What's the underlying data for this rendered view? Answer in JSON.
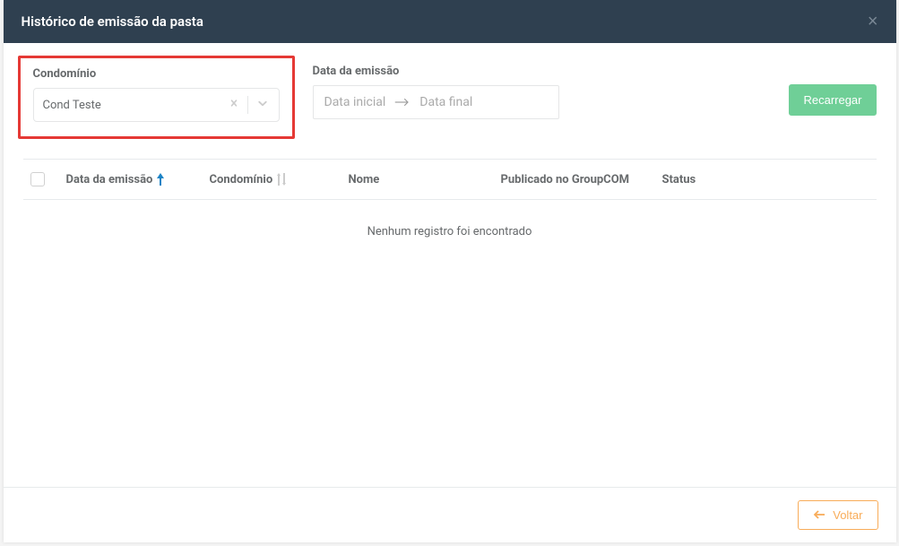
{
  "modal": {
    "title": "Histórico de emissão da pasta"
  },
  "filters": {
    "condominio": {
      "label": "Condomínio",
      "value": "Cond Teste"
    },
    "data_emissao": {
      "label": "Data da emissão",
      "placeholder_start": "Data inicial",
      "placeholder_end": "Data final"
    },
    "reload_label": "Recarregar"
  },
  "table": {
    "columns": {
      "data_emissao": "Data da emissão",
      "condominio": "Condomínio",
      "nome": "Nome",
      "publicado": "Publicado no GroupCOM",
      "status": "Status"
    },
    "empty_message": "Nenhum registro foi encontrado"
  },
  "footer": {
    "back_label": "Voltar"
  }
}
